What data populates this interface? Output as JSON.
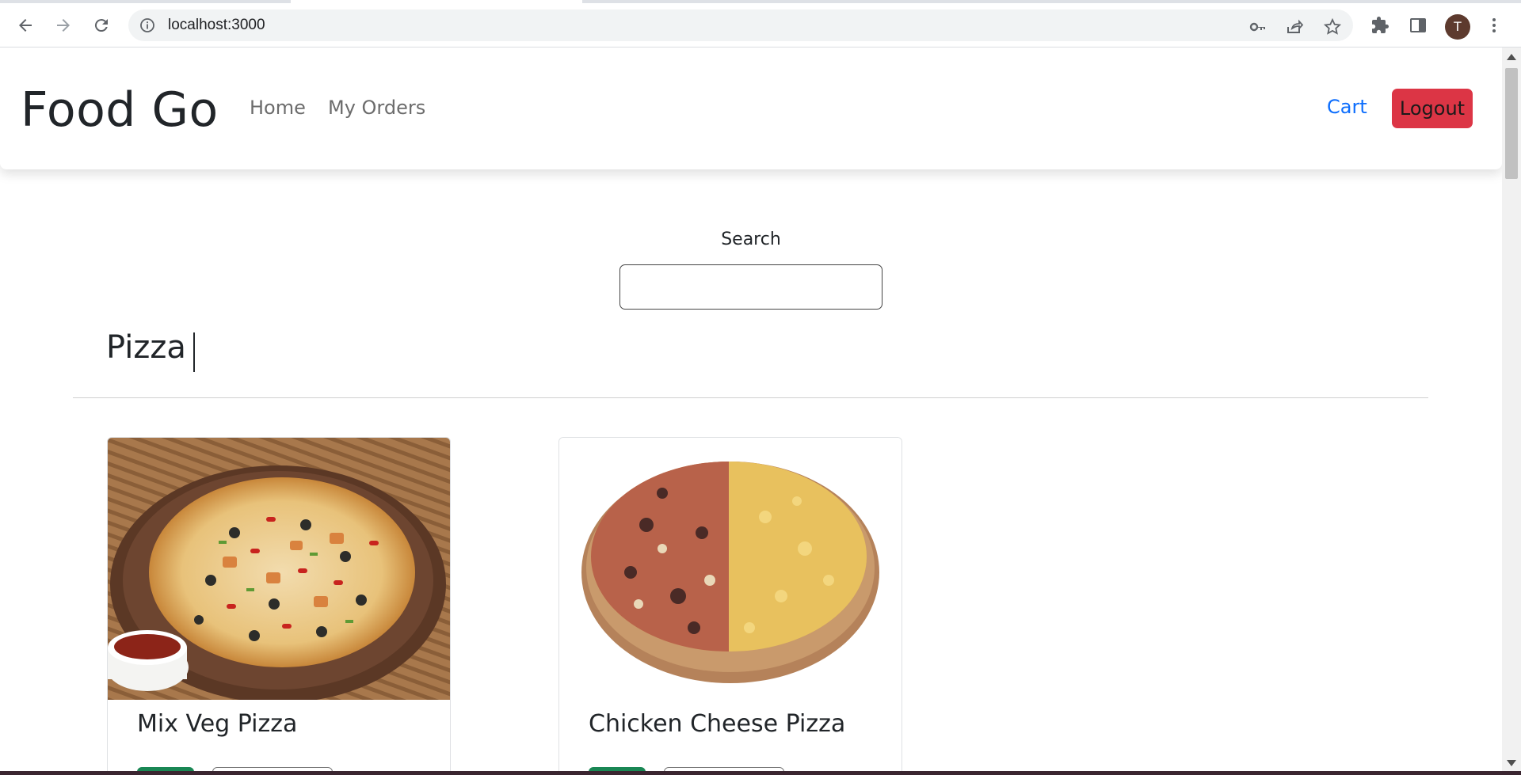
{
  "browser": {
    "url": "localhost:3000",
    "profile_initial": "T",
    "icons": [
      "back-icon",
      "forward-icon",
      "reload-icon",
      "site-info-icon",
      "key-icon",
      "share-icon",
      "bookmark-star-icon",
      "extensions-icon",
      "side-panel-icon",
      "kebab-menu-icon"
    ]
  },
  "navbar": {
    "brand": "Food Go",
    "links": [
      "Home",
      "My Orders"
    ],
    "cart_label": "Cart",
    "logout_label": "Logout"
  },
  "search": {
    "label": "Search",
    "value": ""
  },
  "category": {
    "title": "Pizza"
  },
  "items": [
    {
      "name": "Mix Veg Pizza"
    },
    {
      "name": "Chicken Cheese Pizza"
    }
  ],
  "colors": {
    "accent_link": "#0d6efd",
    "logout_red": "#dc3545",
    "add_green": "#198754"
  }
}
